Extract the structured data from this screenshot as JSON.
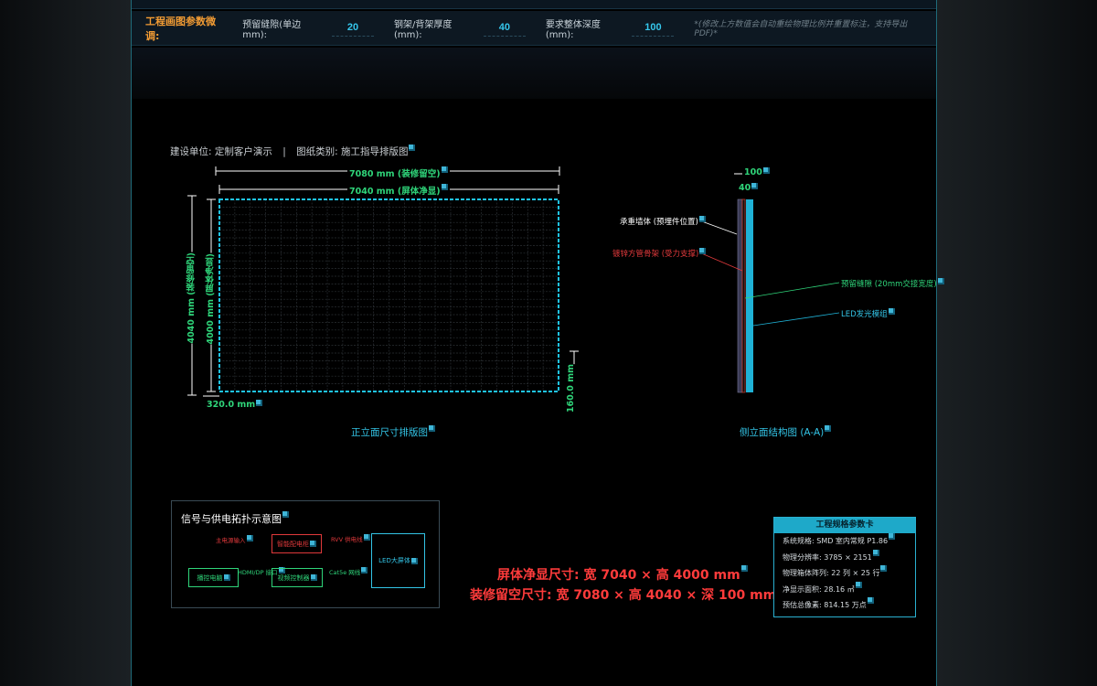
{
  "params": {
    "title": "工程画图参数微调:",
    "gap_label": "预留缝隙(单边 mm):",
    "gap_value": "20",
    "steel_label": "钢架/背架厚度(mm):",
    "steel_value": "40",
    "depth_label": "要求整体深度(mm):",
    "depth_value": "100",
    "hint": "*(修改上方数值会自动重绘物理比例并重置标注，支持导出PDF)*"
  },
  "header": {
    "client": "建设单位: 定制客户演示",
    "separator": "|",
    "drawing_type": "图纸类别: 施工指导排版图"
  },
  "front": {
    "outer_width": "7080 mm (装修留空)",
    "inner_width": "7040 mm (屏体净显)",
    "outer_height": "4040 mm (装修留空)",
    "inner_height": "4000 mm (屏体净显)",
    "module_w": "320.0 mm",
    "module_h": "160.0 mm",
    "caption": "正立面尺寸排版图",
    "grid_cols": 22,
    "grid_rows": 25
  },
  "side": {
    "depth_total": "100",
    "depth_steel": "40",
    "label_wall": "承重墙体 (预埋件位置)",
    "label_steel": "镀锌方管骨架 (受力支撑)",
    "label_gap": "预留缝隙 (20mm交接宽度)",
    "label_led": "LED发光模组",
    "caption": "侧立面结构图 (A-A)"
  },
  "topology": {
    "title": "信号与供电拓扑示意图",
    "main_power": "主电源输入",
    "power_box": "智能配电柜",
    "cable": "RVV 供电线",
    "screen": "LED大屏体",
    "player": "播控电脑",
    "hdmi": "HDMI/DP 接口",
    "controller": "视频控制器",
    "cat6": "Cat5e 网线",
    "colors": {
      "power": "#e0393b",
      "signal": "#2fd57a",
      "screen": "#33c4e6"
    }
  },
  "dims": {
    "screen": "屏体净显尺寸: 宽 7040 × 高 4000 mm",
    "opening": "装修留空尺寸: 宽 7080 × 高 4040 × 深 100 mm"
  },
  "specs": {
    "title": "工程规格参数卡",
    "rows": [
      "系统规格: SMD 室内常规 P1.86",
      "物理分辨率: 3785 × 2151",
      "物理箱体阵列: 22 列 × 25 行",
      "净显示面积: 28.16 ㎡",
      "预估总像素: 814.15 万点"
    ]
  },
  "colors": {
    "accent": "#33c4e6",
    "dimension": "#2fd57a",
    "warning": "#ff3b3b",
    "title": "#f39c34"
  },
  "icons": {
    "marker": "edit-marker-icon"
  }
}
